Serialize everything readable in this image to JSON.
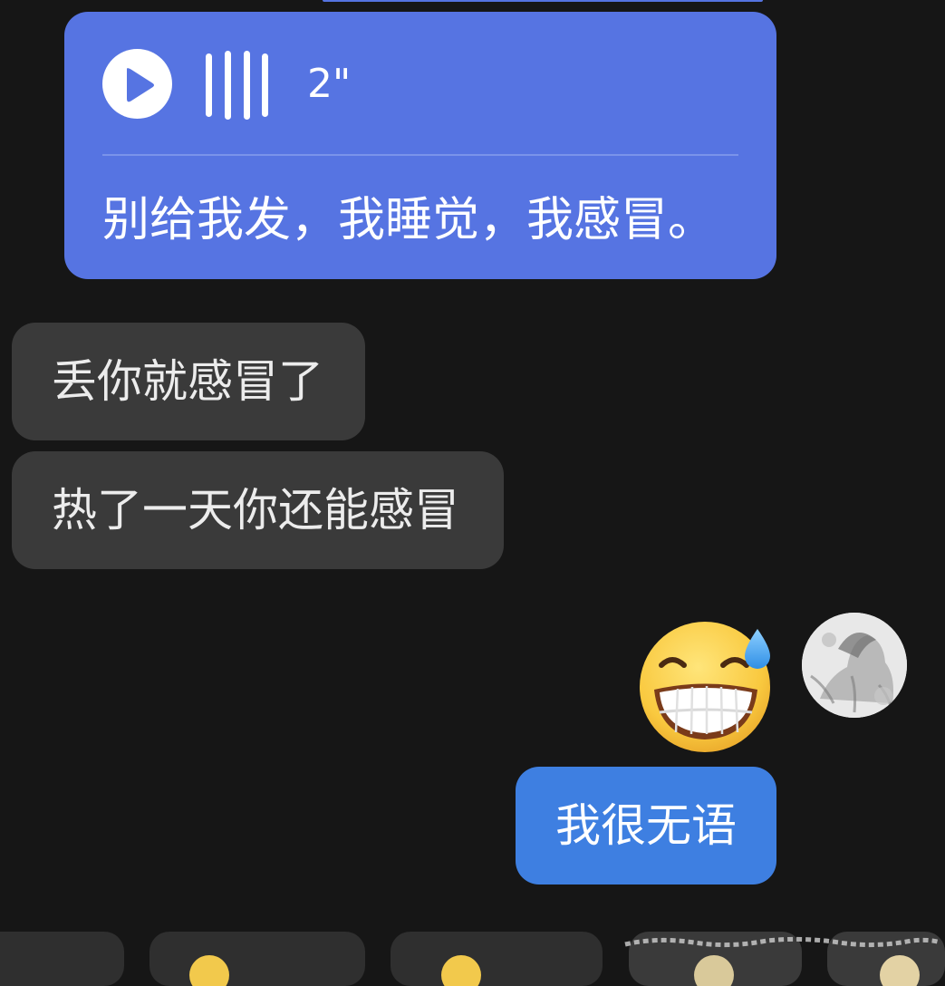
{
  "chat": {
    "voice_message": {
      "duration": "2\"",
      "transcript": "别给我发，我睡觉，我感冒。",
      "play_icon": "play-icon",
      "waveform_icon": "voice-waveform-icon"
    },
    "incoming_messages": [
      "丢你就感冒了",
      "热了一天你还能感冒"
    ],
    "outgoing_sticker": {
      "icon": "grinning-sweat-emoji"
    },
    "outgoing_message": "我很无语"
  },
  "colors": {
    "background": "#161616",
    "voice_bubble": "#5674e2",
    "incoming_bubble": "#3a3a3a",
    "outgoing_bubble": "#3e7fe1",
    "text": "#ffffff"
  }
}
